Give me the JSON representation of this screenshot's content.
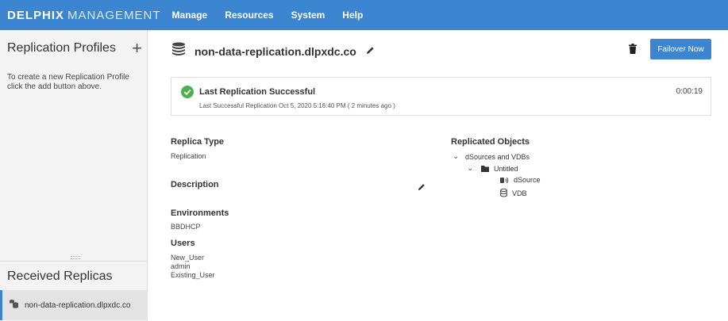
{
  "brand": {
    "primary": "DELPHIX",
    "secondary": "MANAGEMENT"
  },
  "menu": [
    "Manage",
    "Resources",
    "System",
    "Help"
  ],
  "sidebar": {
    "title": "Replication Profiles",
    "add_icon": "plus-icon",
    "hint": "To create a new Replication Profile click the add button above.",
    "received_title": "Received Replicas",
    "received_items": [
      {
        "label": "non-data-replication.dlpxdc.co",
        "icon": "replica-icon"
      }
    ]
  },
  "main": {
    "title": "non-data-replication.dlpxdc.co",
    "failover_label": "Failover Now",
    "status": {
      "title": "Last Replication Successful",
      "subtitle": "Last Successful Replication Oct 5, 2020 5:16:40 PM ( 2 minutes ago )",
      "duration": "0:00:19"
    },
    "replica_type_label": "Replica Type",
    "replica_type_value": "Replication",
    "description_label": "Description",
    "environments_label": "Environments",
    "environments_value": "BBDHCP",
    "users_label": "Users",
    "users": [
      "New_User",
      "admin",
      "Existing_User"
    ],
    "replicated_objects_label": "Replicated Objects",
    "tree": {
      "root": "dSources and VDBs",
      "group": "Untitled",
      "items": [
        {
          "label": "dSource",
          "icon": "dsource-icon"
        },
        {
          "label": "VDB",
          "icon": "database-icon"
        }
      ]
    }
  },
  "colors": {
    "accent": "#3c86d1",
    "success": "#4caf50"
  }
}
